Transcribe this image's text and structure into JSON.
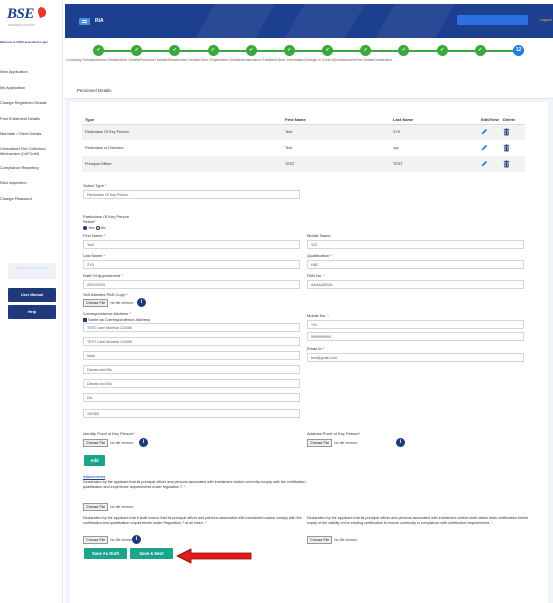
{
  "sidebar": {
    "logo_text": "BSE",
    "logo_subtext": "EXPERIENCE THE NEW",
    "welcome": "Welcome to IA/RA Investment Login",
    "items": [
      {
        "label": "New Application"
      },
      {
        "label": "My Application"
      },
      {
        "label": "Change Registered Details"
      },
      {
        "label": "Post Enlistment Details"
      },
      {
        "label": "Mandate / Client Details"
      },
      {
        "label": "Centralised Fee Collection Mechanism (CeFCoM)"
      },
      {
        "label": "Compliance Reporting"
      },
      {
        "label": "RAA Inspection"
      },
      {
        "label": "Change Password"
      }
    ],
    "inactive_box": "RIA - Portal Guidance Video",
    "user_manual": "User Manual",
    "help": "Help"
  },
  "header": {
    "title": "RIA",
    "logout": "Logout"
  },
  "stepper": {
    "steps": [
      {
        "label": "Company Details"
      },
      {
        "label": "Address Details"
      },
      {
        "label": "Other Details"
      },
      {
        "label": "Personnel Details"
      },
      {
        "label": "Shareholder Details"
      },
      {
        "label": "Other Registration Details"
      },
      {
        "label": "Infrastructure Facilities"
      },
      {
        "label": "Other Information"
      },
      {
        "label": "Change in Control"
      },
      {
        "label": "Questionnaire"
      },
      {
        "label": "Fee Details"
      },
      {
        "label": "Declaration"
      }
    ],
    "current_number": "12"
  },
  "page": {
    "title": "Personnel Details"
  },
  "table": {
    "headers": [
      "Type",
      "First Name",
      "Last Name",
      "Edit/View",
      "Delete"
    ],
    "rows": [
      [
        "Particulars Of Key Person",
        "Test",
        "ZYX"
      ],
      [
        "Particulars of Directors",
        "Test",
        "xyz"
      ],
      [
        "Principal Officer",
        "TEST",
        "TEST"
      ]
    ]
  },
  "form": {
    "select_type_label": "Select Type",
    "select_type_value": "Particulars Of Key Person",
    "section_heading": "Particulars Of Key Person",
    "select_label": "Select",
    "radio_yes": "Yes",
    "radio_no": "No",
    "first_name_label": "First Name",
    "first_name_value": "Test",
    "middle_name_label": "Middle Name",
    "middle_name_value": "123",
    "last_name_label": "Last Name",
    "last_name_value": "ZYX",
    "qualification_label": "Qualification",
    "qualification_value": "HBC",
    "doa_label": "Date Of Appointment",
    "doa_value": "20/01/2025",
    "pan_label": "PAN No.",
    "pan_value": "AAAAA0004L",
    "pan_copy_label": "Self Attested PAN Copy",
    "choose_file": "Choose File",
    "no_file": "No file chosen",
    "corr_address_label": "Correspondence Address",
    "same_as_label": "Same as Correspondence Address",
    "addr1": "TEST Lane Mumbai 123456",
    "addr2": "TEST Lane Mumbai 123456",
    "country": "India",
    "state": "Daman and Diu",
    "district": "Daman and Diu",
    "city": "Diu",
    "pincode": "152365",
    "mobile_label": "Mobile No.",
    "mobile_code": "+91",
    "mobile_value": "9999999999",
    "email_label": "Email Id",
    "email_value": "test@gmail.com",
    "identity_label": "Identity Proof of Key Person",
    "address_proof_label": "Address Proof of Key Person",
    "add_button": "Add",
    "attachments_heading": "Attachments",
    "decl1": "Declaration by the applicant that its principal officer and persons associated with investment advice currently comply with the certification, qualification and experience requirements under regulation 7.",
    "decl2": "Declaration by the applicant that it shall ensure that its principal officer and persons associated with investment advice comply with the certification and qualification requirements under Regulation 7 at all times.",
    "decl3": "Declaration by the applicant that its principal officer and persons associated with investment advice shall obtain fresh certification before expiry of the validity of the existing certification to ensure continuity in compliance with certification requirements.",
    "save_draft": "Save As Draft",
    "save_next": "Save & Next"
  },
  "colors": {
    "navy": "#1d3f8f",
    "step_green": "#3aa83a",
    "active_step": "#1f7fe0",
    "action_teal": "#1aa58a",
    "arrow_red": "#e01b1b"
  }
}
